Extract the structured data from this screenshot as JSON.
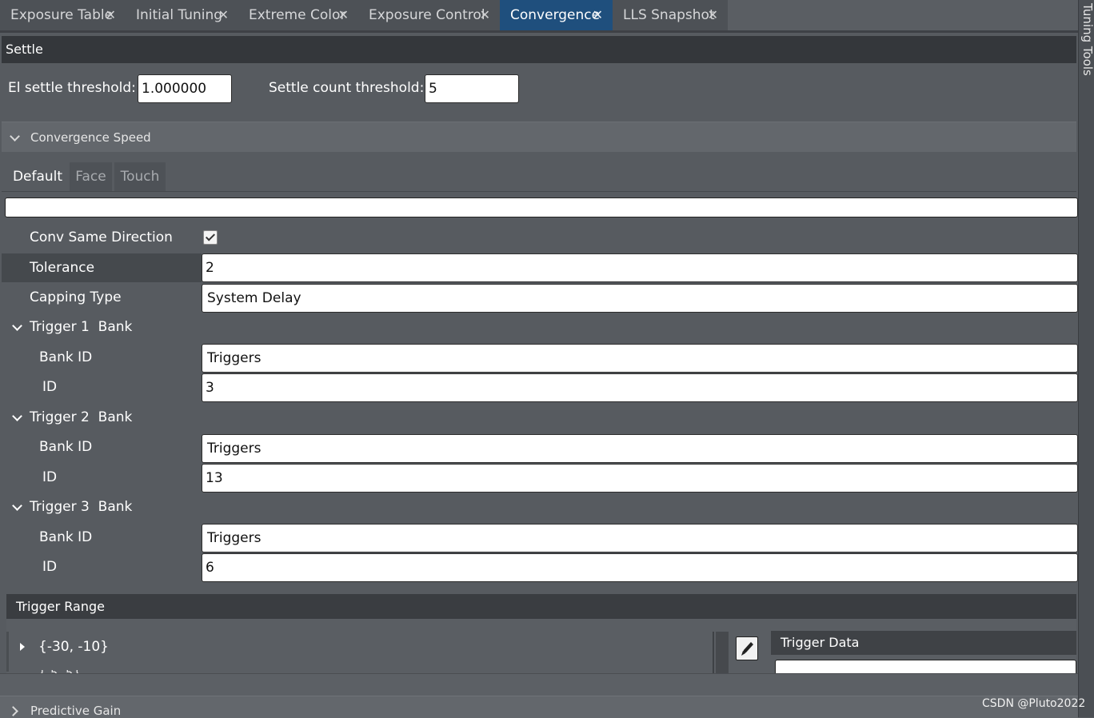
{
  "tabs": [
    {
      "label": "Exposure Table"
    },
    {
      "label": "Initial Tuning"
    },
    {
      "label": "Extreme Color"
    },
    {
      "label": "Exposure Control"
    },
    {
      "label": "Convergence"
    },
    {
      "label": "LLS Snapshot"
    }
  ],
  "active_tab": "Convergence",
  "right_panel_label": "Tuning Tools",
  "settle": {
    "header": "Settle",
    "el_label": "El settle threshold:",
    "el_value": "1.000000",
    "count_label": "Settle count threshold:",
    "count_value": "5"
  },
  "convergence_speed": {
    "label": "Convergence Speed",
    "subtabs": [
      "Default",
      "Face",
      "Touch"
    ],
    "active_subtab": "Default"
  },
  "properties": {
    "conv_same_direction": {
      "label": "Conv Same Direction",
      "checked": true
    },
    "tolerance": {
      "label": "Tolerance",
      "value": "2"
    },
    "capping_type": {
      "label": "Capping Type",
      "value": "System Delay"
    },
    "triggers": [
      {
        "label": "Trigger 1  Bank",
        "bank_label": "Bank ID",
        "bank_value": "Triggers",
        "id_label": "ID",
        "id_value": "3"
      },
      {
        "label": "Trigger 2  Bank",
        "bank_label": "Bank ID",
        "bank_value": "Triggers",
        "id_label": "ID",
        "id_value": "13"
      },
      {
        "label": "Trigger 3  Bank",
        "bank_label": "Bank ID",
        "bank_value": "Triggers",
        "id_label": "ID",
        "id_value": "6"
      }
    ]
  },
  "trigger_range": {
    "header": "Trigger Range",
    "first_item": "{-30, -10}",
    "data_header": "Trigger Data"
  },
  "predictive_gain": {
    "label": "Predictive Gain"
  },
  "watermark": "CSDN @Pluto2022"
}
